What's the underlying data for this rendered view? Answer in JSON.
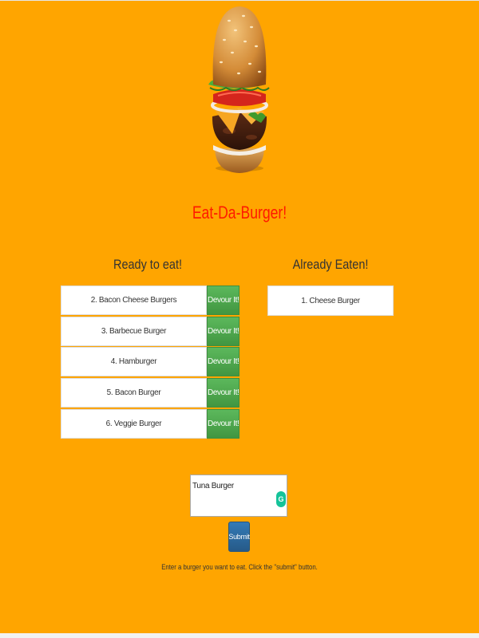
{
  "app": {
    "title": "Eat-Da-Burger!",
    "logo_icon": "burger-icon"
  },
  "ready": {
    "heading": "Ready to eat!",
    "items": [
      {
        "label": "2. Bacon Cheese Burgers",
        "button": "Devour It!"
      },
      {
        "label": "3. Barbecue Burger",
        "button": "Devour It!"
      },
      {
        "label": "4. Hamburger",
        "button": "Devour It!"
      },
      {
        "label": "5. Bacon Burger",
        "button": "Devour It!"
      },
      {
        "label": "6. Veggie Burger",
        "button": "Devour It!"
      }
    ]
  },
  "eaten": {
    "heading": "Already Eaten!",
    "items": [
      {
        "label": "1. Cheese Burger"
      }
    ]
  },
  "form": {
    "input_value": "Tuna Burger",
    "grammar_icon": "grammarly-icon",
    "submit_label": "Submit",
    "instructions": "Enter a burger you want to eat. Click the \"submit\" button."
  },
  "colors": {
    "background": "#ffa500",
    "title": "#ff1a00",
    "devour_button": "#5cb85c",
    "submit_button": "#337ab7"
  }
}
